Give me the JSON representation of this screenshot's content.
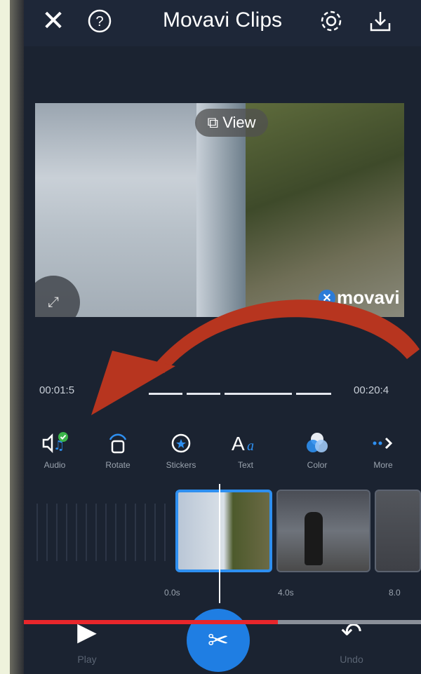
{
  "header": {
    "title": "Movavi Clips",
    "close_icon": "close-icon",
    "help_icon": "help-icon",
    "settings_icon": "gear-icon",
    "export_icon": "download-icon"
  },
  "preview": {
    "view_label": "View",
    "watermark_text": "movavi"
  },
  "timeline": {
    "current_time": "00:01:5",
    "total_time": "00:20:4",
    "ruler": [
      "0.0s",
      "4.0s",
      "8.0"
    ]
  },
  "tools": [
    {
      "label": "Audio",
      "icon": "audio-icon"
    },
    {
      "label": "Rotate",
      "icon": "rotate-icon"
    },
    {
      "label": "Stickers",
      "icon": "sticker-icon"
    },
    {
      "label": "Text",
      "icon": "text-icon"
    },
    {
      "label": "Color",
      "icon": "color-icon"
    },
    {
      "label": "More",
      "icon": "more-icon"
    }
  ],
  "bottom": {
    "play_label": "Play",
    "undo_label": "Undo"
  },
  "video_progress": 0.66,
  "colors": {
    "accent": "#1f7ee3",
    "annotation_arrow": "#b7351f",
    "progress": "#e8262b"
  }
}
